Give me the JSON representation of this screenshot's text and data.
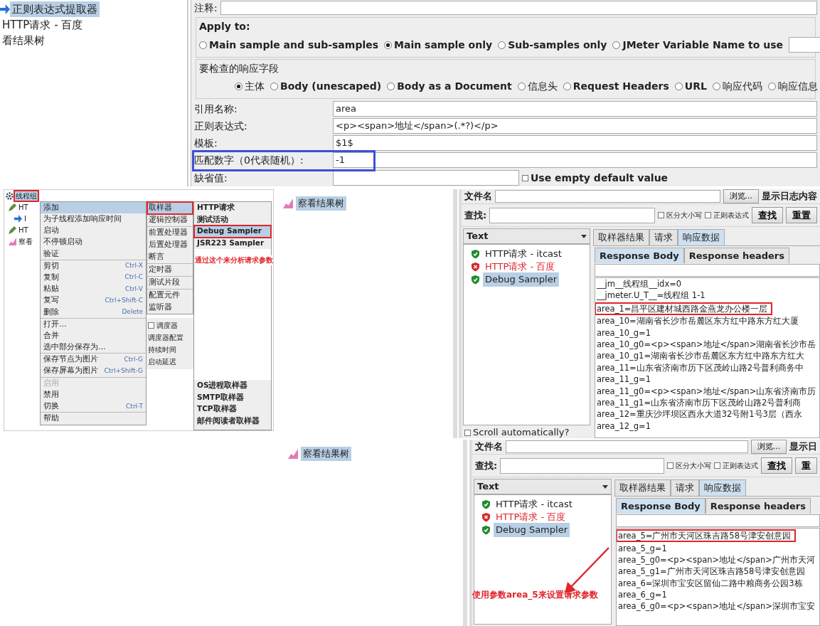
{
  "extractor_tree": {
    "items": [
      {
        "label": "正则表达式提取器",
        "kind": "extractor",
        "selected": true
      },
      {
        "label": "HTTP请求 - 百度",
        "kind": "plain",
        "selected": false
      },
      {
        "label": "看结果树",
        "kind": "plain",
        "selected": false
      }
    ]
  },
  "extractor_form": {
    "comment_label": "注释:",
    "apply_to": {
      "title": "Apply to:",
      "options": [
        {
          "label": "Main sample and sub-samples",
          "selected": false
        },
        {
          "label": "Main sample only",
          "selected": true
        },
        {
          "label": "Sub-samples only",
          "selected": false
        },
        {
          "label": "JMeter Variable Name to use",
          "selected": false
        }
      ]
    },
    "response_field": {
      "title": "要检查的响应字段",
      "options": [
        {
          "label": "主体",
          "selected": true
        },
        {
          "label": "Body (unescaped)",
          "selected": false
        },
        {
          "label": "Body as a Document",
          "selected": false
        },
        {
          "label": "信息头",
          "selected": false
        },
        {
          "label": "Request Headers",
          "selected": false
        },
        {
          "label": "URL",
          "selected": false
        },
        {
          "label": "响应代码",
          "selected": false
        },
        {
          "label": "响应信息",
          "selected": false
        }
      ]
    },
    "fields": [
      {
        "label": "引用名称:",
        "value": "area",
        "highlighted": false
      },
      {
        "label": "正则表达式:",
        "value": "<p><span>地址</span>(.*?)</p>",
        "highlighted": false
      },
      {
        "label": "模板:",
        "value": "$1$",
        "highlighted": false
      },
      {
        "label": "匹配数字（0代表随机）:",
        "value": "-1",
        "highlighted": true
      }
    ],
    "default_label": "缺省值:",
    "default_checkbox": {
      "label": "Use empty default value",
      "checked": false
    }
  },
  "menu_screen": {
    "tree": [
      {
        "label": "线程组",
        "kind": "group",
        "highlighted": true
      },
      {
        "label": "HT",
        "kind": "sampler",
        "highlighted": false
      },
      {
        "label": "I",
        "kind": "extractor",
        "highlighted": false
      },
      {
        "label": "HT",
        "kind": "sampler",
        "highlighted": false
      },
      {
        "label": "察看",
        "kind": "listener",
        "highlighted": false
      }
    ],
    "menu": [
      [
        {
          "label": "添加",
          "selected": true,
          "disabled": false
        },
        {
          "label": "为子线程添加响应时间",
          "selected": false,
          "disabled": false
        },
        {
          "label": "启动",
          "selected": false,
          "disabled": false
        },
        {
          "label": "不停顿启动",
          "selected": false,
          "disabled": false
        },
        {
          "label": "验证",
          "selected": false,
          "disabled": false
        }
      ],
      [
        {
          "label": "剪切",
          "shortcut": "Ctrl-X",
          "selected": false,
          "disabled": false
        },
        {
          "label": "复制",
          "shortcut": "Ctrl-C",
          "selected": false,
          "disabled": false
        },
        {
          "label": "粘贴",
          "shortcut": "Ctrl-V",
          "selected": false,
          "disabled": false
        },
        {
          "label": "复写",
          "shortcut": "Ctrl+Shift-C",
          "selected": false,
          "disabled": false
        },
        {
          "label": "删除",
          "shortcut": "Delete",
          "selected": false,
          "disabled": false
        }
      ],
      [
        {
          "label": "打开...",
          "selected": false,
          "disabled": false
        },
        {
          "label": "合并",
          "selected": false,
          "disabled": false
        },
        {
          "label": "选中部分保存为...",
          "selected": false,
          "disabled": false
        }
      ],
      [
        {
          "label": "保存节点为图片",
          "shortcut": "Ctrl-G",
          "selected": false,
          "disabled": false
        },
        {
          "label": "保存屏幕为图片",
          "shortcut": "Ctrl+Shift-G",
          "selected": false,
          "disabled": false
        }
      ],
      [
        {
          "label": "启用",
          "selected": false,
          "disabled": true
        },
        {
          "label": "禁用",
          "selected": false,
          "disabled": false
        },
        {
          "label": "切换",
          "shortcut": "Ctrl-T",
          "selected": false,
          "disabled": false
        }
      ],
      [
        {
          "label": "帮助",
          "selected": false,
          "disabled": false
        }
      ]
    ],
    "submenu": [
      [
        {
          "label": "取样器",
          "selected": true
        },
        {
          "label": "逻辑控制器",
          "selected": false
        }
      ],
      [
        {
          "label": "前置处理器",
          "selected": false
        },
        {
          "label": "后置处理器",
          "selected": false
        },
        {
          "label": "断言",
          "selected": false
        }
      ],
      [
        {
          "label": "定时器",
          "selected": false
        }
      ],
      [
        {
          "label": "测试片段",
          "selected": false
        }
      ],
      [
        {
          "label": "配置元件",
          "selected": false
        },
        {
          "label": "监听器",
          "selected": false
        }
      ]
    ],
    "background_labels": [
      {
        "label": "调度器",
        "kind": "checkbox"
      },
      {
        "label": "调度器配置",
        "kind": "text"
      },
      {
        "label": "持续时间",
        "kind": "text"
      },
      {
        "label": "启动延迟",
        "kind": "text"
      }
    ],
    "samplers_top": [
      {
        "label": "HTTP请求",
        "selected": false
      },
      {
        "label": "测试活动",
        "selected": false
      },
      {
        "label": "Debug Sampler",
        "selected": true
      },
      {
        "label": "JSR223 Sampler",
        "selected": false
      }
    ],
    "samplers_bottom": [
      {
        "label": "OS进程取样器",
        "selected": false
      },
      {
        "label": "SMTP取样器",
        "selected": false
      },
      {
        "label": "TCP取样器",
        "selected": false
      },
      {
        "label": "邮件阅读者取样器",
        "selected": false
      }
    ],
    "annotation": "通过这个来分析请求参数"
  },
  "result_trees": [
    {
      "items": [
        {
          "label": "察看结果树",
          "selected": true
        }
      ]
    },
    {
      "items": [
        {
          "label": "察看结果树",
          "selected": true
        }
      ]
    }
  ],
  "results_views": [
    {
      "file_label": "文件名",
      "browse_button": "浏览...",
      "log_label": "显示日志内容",
      "search_label": "查找:",
      "checkboxes": [
        {
          "label": "区分大小写",
          "checked": false
        },
        {
          "label": "正则表达式",
          "checked": false
        }
      ],
      "buttons": [
        "查找",
        "重置"
      ],
      "renderer": "Text",
      "samples": [
        {
          "label": "HTTP请求 - itcast",
          "kind": "success",
          "selected": false
        },
        {
          "label": "HTTP请求 - 百度",
          "kind": "failure",
          "selected": false
        },
        {
          "label": "Debug Sampler",
          "kind": "success",
          "selected": true
        }
      ],
      "tabs": [
        {
          "label": "取样器结果",
          "selected": false
        },
        {
          "label": "请求",
          "selected": false
        },
        {
          "label": "响应数据",
          "selected": true
        }
      ],
      "subtabs": [
        {
          "label": "Response Body",
          "selected": true
        },
        {
          "label": "Response headers",
          "selected": false
        }
      ],
      "lines": [
        {
          "text": "__jm__线程组__idx=0",
          "highlighted": false
        },
        {
          "text": "__jmeter.U_T__=线程组 1-1",
          "highlighted": false
        },
        {
          "text": "area_1=昌平区建材城西路金燕龙办公楼一层",
          "highlighted": true
        },
        {
          "text": "area_10=湖南省长沙市岳麓区东方红中路东方红大厦",
          "highlighted": false
        },
        {
          "text": "area_10_g=1",
          "highlighted": false
        },
        {
          "text": "area_10_g0=<p><span>地址</span>湖南省长沙市岳",
          "highlighted": false
        },
        {
          "text": "area_10_g1=湖南省长沙市岳麓区东方红中路东方红大",
          "highlighted": false
        },
        {
          "text": "area_11=山东省济南市历下区茂岭山路2号普利商务中",
          "highlighted": false
        },
        {
          "text": "area_11_g=1",
          "highlighted": false
        },
        {
          "text": "area_11_g0=<p><span>地址</span>山东省济南市历",
          "highlighted": false
        },
        {
          "text": "area_11_g1=山东省济南市历下区茂岭山路2号普利商",
          "highlighted": false
        },
        {
          "text": "area_12=重庆沙坪坝区西永大道32号附1号3层（西永",
          "highlighted": false
        },
        {
          "text": "area_12_g=1",
          "highlighted": false
        }
      ],
      "scroll_checkbox": {
        "label": "Scroll automatically?",
        "checked": false
      }
    },
    {
      "file_label": "文件名",
      "browse_button": "浏览...",
      "log_label": "显示日",
      "search_label": "查找:",
      "checkboxes": [
        {
          "label": "区分大小写",
          "checked": false
        },
        {
          "label": "正则表达式",
          "checked": false
        }
      ],
      "buttons": [
        "查找",
        "重"
      ],
      "renderer": "Text",
      "samples": [
        {
          "label": "HTTP请求 - itcast",
          "kind": "success",
          "selected": false
        },
        {
          "label": "HTTP请求 - 百度",
          "kind": "failure",
          "selected": false
        },
        {
          "label": "Debug Sampler",
          "kind": "success",
          "selected": true
        }
      ],
      "tabs": [
        {
          "label": "取样器结果",
          "selected": false
        },
        {
          "label": "请求",
          "selected": false
        },
        {
          "label": "响应数据",
          "selected": true
        }
      ],
      "subtabs": [
        {
          "label": "Response Body",
          "selected": true
        },
        {
          "label": "Response headers",
          "selected": false
        }
      ],
      "lines": [
        {
          "text": "area_5=广州市天河区珠吉路58号津安创意园",
          "highlighted": true
        },
        {
          "text": "area_5_g=1",
          "highlighted": false
        },
        {
          "text": "area_5_g0=<p><span>地址</span>广州市天河",
          "highlighted": false
        },
        {
          "text": "area_5_g1=广州市天河区珠吉路58号津安创意园",
          "highlighted": false
        },
        {
          "text": "area_6=深圳市宝安区留仙二路中粮商务公园3栋",
          "highlighted": false
        },
        {
          "text": "area_6_g=1",
          "highlighted": false
        },
        {
          "text": "area_6_g0=<p><span>地址</span>深圳市宝安",
          "highlighted": false
        }
      ],
      "annotation": "使用参数area_5来设置请求参数"
    }
  ]
}
